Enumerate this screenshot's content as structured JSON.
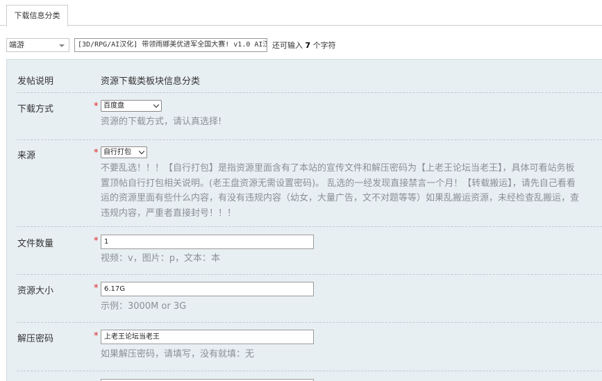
{
  "tabs": {
    "active_label": "下载信息分类"
  },
  "title_row": {
    "type_select": "端游",
    "title_value": "[3D/RPG/AI汉化] 带领雨娜美优进军全国大赛! v1.0 AI汉",
    "char_left_prefix": "还可输入",
    "char_left_count": "7",
    "char_left_suffix": "个字符"
  },
  "form": {
    "intro": {
      "label": "发帖说明",
      "text": "资源下载类板块信息分类"
    },
    "download_method": {
      "label": "下载方式",
      "required_mark": "*",
      "selected": "百度盘",
      "hint": "资源的下载方式，请认真选择!"
    },
    "source": {
      "label": "来源",
      "required_mark": "*",
      "selected": "自行打包",
      "hint_lines": [
        "不要乱选！！！【自行打包】是指资源里面含有了本站的宣传文件和解压密码为【上老王论坛当老王】，具体可看站务板",
        "置顶帖自行打包相关说明。(老王盘资源无需设置密码)。 乱选的一经发现直接禁言一个月！【转载搬运】，请先自己看看",
        "运的资源里面有些什么内容，有没有违规内容（幼女，大量广告，文不对题等等）如果乱搬运资源，未经检查乱搬运，查",
        "违规内容，严重者直接封号！！！"
      ]
    },
    "file_count": {
      "label": "文件数量",
      "required_mark": "*",
      "value": "1",
      "hint": "视频：v，图片：p，文本：本"
    },
    "resource_size": {
      "label": "资源大小",
      "required_mark": "*",
      "value": "6.17G",
      "hint": "示例：3000M or 3G"
    },
    "unzip_password": {
      "label": "解压密码",
      "required_mark": "*",
      "value": "上老王论坛当老王",
      "hint": "如果解压密码，请填写，没有就填：无"
    }
  }
}
